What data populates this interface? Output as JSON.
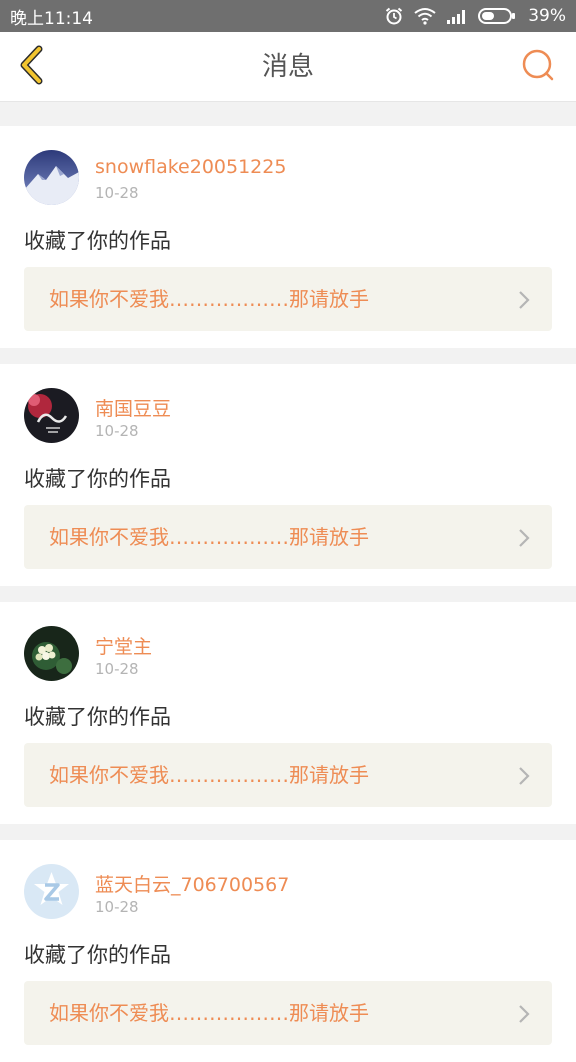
{
  "status_bar": {
    "time": "晚上11:14",
    "battery": "39%",
    "icons": [
      "alarm-icon",
      "wifi-icon",
      "signal-icon",
      "battery-icon"
    ]
  },
  "header": {
    "title": "消息",
    "back_icon": "chevron-left-icon",
    "search_icon": "search-icon"
  },
  "colors": {
    "accent": "#ee8c54",
    "back_icon_yellow": "#f2c530",
    "back_icon_dark": "#2b2b2b",
    "card_link_bg": "#f4f3ec",
    "page_bg": "#f2f2f2"
  },
  "messages": [
    {
      "username": "snowflake20051225",
      "date": "10-28",
      "action": "收藏了你的作品",
      "work_title": "如果你不爱我………………那请放手",
      "avatar": "snow-mountain-avatar"
    },
    {
      "username": "南国豆豆",
      "date": "10-28",
      "action": "收藏了你的作品",
      "work_title": "如果你不爱我………………那请放手",
      "avatar": "dark-calligraphy-avatar"
    },
    {
      "username": "宁堂主",
      "date": "10-28",
      "action": "收藏了你的作品",
      "work_title": "如果你不爱我………………那请放手",
      "avatar": "flower-avatar"
    },
    {
      "username": "蓝天白云_706700567",
      "date": "10-28",
      "action": "收藏了你的作品",
      "work_title": "如果你不爱我………………那请放手",
      "avatar": "default-z-avatar"
    }
  ]
}
